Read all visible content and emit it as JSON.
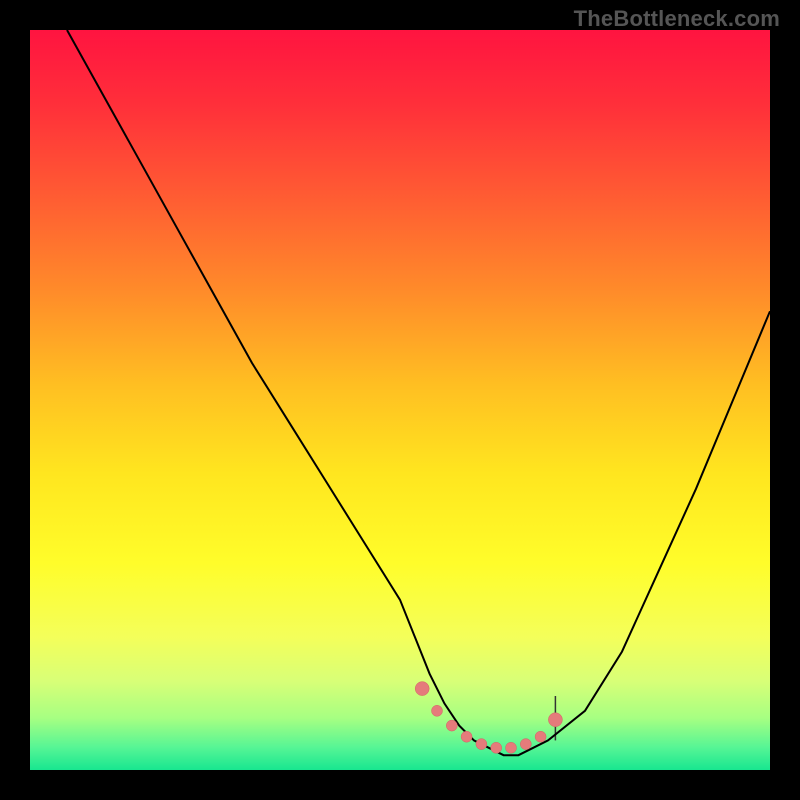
{
  "watermark": "TheBottleneck.com",
  "colors": {
    "frame": "#000000",
    "curve": "#000000",
    "dots": "#e57b7b",
    "dots_stroke": "#d26363",
    "tick": "#333333",
    "gradient_stops": [
      {
        "offset": 0.0,
        "color": "#ff1440"
      },
      {
        "offset": 0.1,
        "color": "#ff2f3a"
      },
      {
        "offset": 0.22,
        "color": "#ff5a33"
      },
      {
        "offset": 0.35,
        "color": "#ff8a2a"
      },
      {
        "offset": 0.48,
        "color": "#ffbf22"
      },
      {
        "offset": 0.6,
        "color": "#ffe61f"
      },
      {
        "offset": 0.72,
        "color": "#fffd2a"
      },
      {
        "offset": 0.82,
        "color": "#f4ff5a"
      },
      {
        "offset": 0.88,
        "color": "#d8ff77"
      },
      {
        "offset": 0.93,
        "color": "#a6ff82"
      },
      {
        "offset": 0.97,
        "color": "#55f595"
      },
      {
        "offset": 1.0,
        "color": "#18e690"
      }
    ]
  },
  "chart_data": {
    "type": "line",
    "title": "",
    "xlabel": "",
    "ylabel": "",
    "xlim": [
      0,
      100
    ],
    "ylim": [
      0,
      100
    ],
    "series": [
      {
        "name": "bottleneck-curve",
        "x": [
          5,
          10,
          15,
          20,
          25,
          30,
          35,
          40,
          45,
          50,
          52,
          54,
          56,
          58,
          60,
          62,
          64,
          66,
          68,
          70,
          75,
          80,
          85,
          90,
          95,
          100
        ],
        "y": [
          100,
          91,
          82,
          73,
          64,
          55,
          47,
          39,
          31,
          23,
          18,
          13,
          9,
          6,
          4,
          3,
          2,
          2,
          3,
          4,
          8,
          16,
          27,
          38,
          50,
          62
        ]
      }
    ],
    "highlight_dots": {
      "name": "optimal-range",
      "x": [
        53,
        55,
        57,
        59,
        61,
        63,
        65,
        67,
        69,
        71
      ],
      "y": [
        11,
        8,
        6,
        4.5,
        3.5,
        3,
        3,
        3.5,
        4.5,
        6.8
      ]
    },
    "tick_x": 71
  }
}
